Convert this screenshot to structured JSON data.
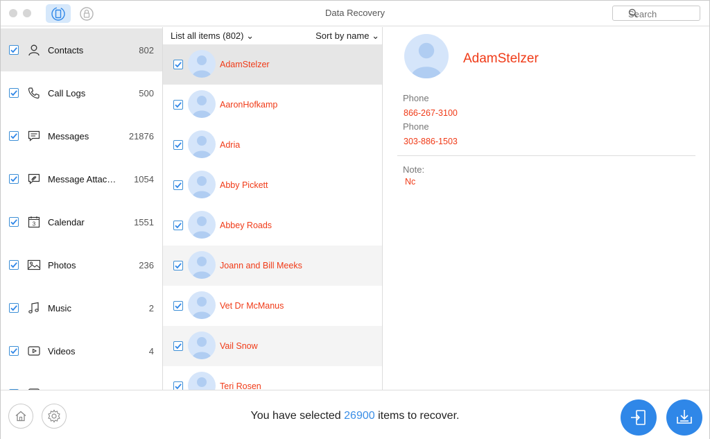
{
  "window": {
    "title": "Data Recovery"
  },
  "search": {
    "placeholder": "Search"
  },
  "sidebar": {
    "items": [
      {
        "label": "Contacts",
        "count": "802",
        "icon": "contacts-icon"
      },
      {
        "label": "Call Logs",
        "count": "500",
        "icon": "phone-icon"
      },
      {
        "label": "Messages",
        "count": "21876",
        "icon": "message-icon"
      },
      {
        "label": "Message Attac…",
        "count": "1054",
        "icon": "attachment-icon"
      },
      {
        "label": "Calendar",
        "count": "1551",
        "icon": "calendar-icon"
      },
      {
        "label": "Photos",
        "count": "236",
        "icon": "photo-icon"
      },
      {
        "label": "Music",
        "count": "2",
        "icon": "music-icon"
      },
      {
        "label": "Videos",
        "count": "4",
        "icon": "video-icon"
      }
    ],
    "selected": 0
  },
  "list": {
    "header_left": "List all items (802)",
    "header_right": "Sort by name",
    "contacts": [
      "AdamStelzer",
      "AaronHofkamp",
      "Adria",
      "Abby Pickett",
      "Abbey Roads",
      "Joann and Bill Meeks",
      "Vet Dr McManus",
      "Vail Snow",
      "Teri Rosen"
    ]
  },
  "detail": {
    "name": "AdamStelzer",
    "phone_label_1": "Phone",
    "phone_1": "866-267-3100",
    "phone_label_2": "Phone",
    "phone_2": "303-886-1503",
    "note_label": "Note:",
    "note": "Nc"
  },
  "footer": {
    "status_prefix": "You have selected ",
    "status_count": "26900",
    "status_suffix": " items to recover."
  },
  "colors": {
    "accent": "#2f87e8",
    "contact_text": "#f03a17",
    "avatar_bg": "#d5e5fa"
  }
}
